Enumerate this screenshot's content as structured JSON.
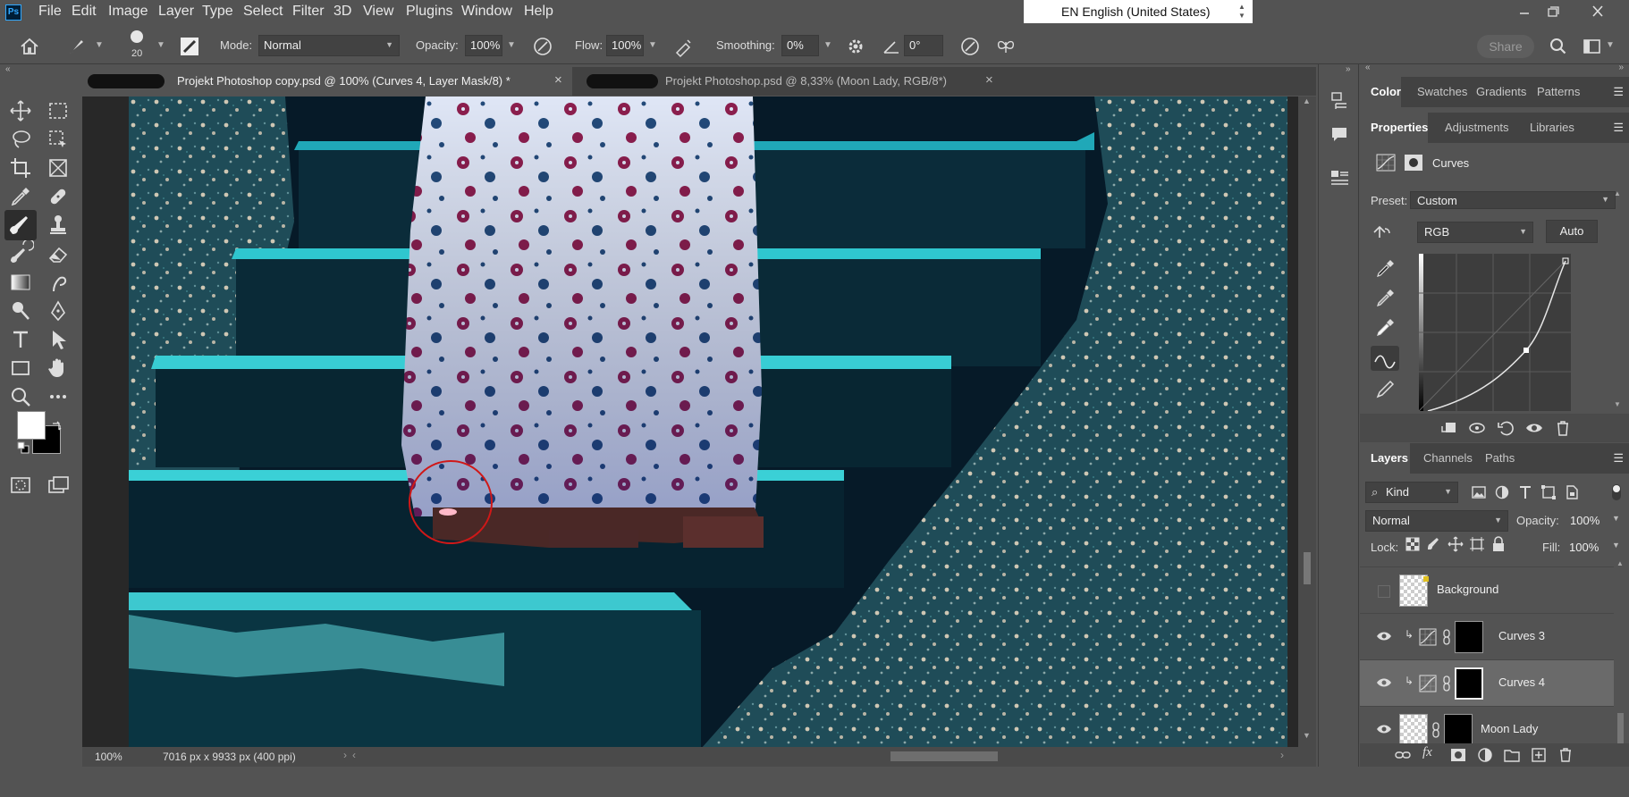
{
  "menubar": {
    "logo": "Ps",
    "items": [
      "File",
      "Edit",
      "Image",
      "Layer",
      "Type",
      "Select",
      "Filter",
      "3D",
      "View",
      "Plugins",
      "Window",
      "Help"
    ],
    "language": "EN English (United States)"
  },
  "options": {
    "brush_size": "20",
    "mode_label": "Mode:",
    "mode_value": "Normal",
    "opacity_label": "Opacity:",
    "opacity_value": "100%",
    "flow_label": "Flow:",
    "flow_value": "100%",
    "smoothing_label": "Smoothing:",
    "smoothing_value": "0%",
    "angle_value": "0°",
    "share_label": "Share"
  },
  "documents": {
    "tab1": "Projekt Photoshop copy.psd @ 100% (Curves 4, Layer Mask/8) *",
    "tab2": "Projekt Photoshop.psd @ 8,33% (Moon Lady, RGB/8*)",
    "close_glyph": "×"
  },
  "status": {
    "zoom": "100%",
    "doc_info": "7016 px x 9933 px (400 ppi)"
  },
  "color_panel": {
    "tabs": [
      "Color",
      "Swatches",
      "Gradients",
      "Patterns"
    ]
  },
  "properties": {
    "tabs": [
      "Properties",
      "Adjustments",
      "Libraries"
    ],
    "title": "Curves",
    "preset_label": "Preset:",
    "preset_value": "Custom",
    "channel_value": "RGB",
    "auto_label": "Auto"
  },
  "layers_panel": {
    "tabs": [
      "Layers",
      "Channels",
      "Paths"
    ],
    "filter_value": "Kind",
    "blend_mode": "Normal",
    "opacity_label": "Opacity:",
    "opacity_value": "100%",
    "lock_label": "Lock:",
    "fill_label": "Fill:",
    "fill_value": "100%",
    "layers": [
      {
        "name": "Background",
        "visible": false,
        "selected": false
      },
      {
        "name": "Curves 3",
        "visible": true,
        "selected": false
      },
      {
        "name": "Curves 4",
        "visible": true,
        "selected": true
      },
      {
        "name": "Moon Lady",
        "visible": true,
        "selected": false
      }
    ]
  },
  "colors": {
    "accent": "#31a8ff",
    "annotation_circle": "#d01818"
  }
}
